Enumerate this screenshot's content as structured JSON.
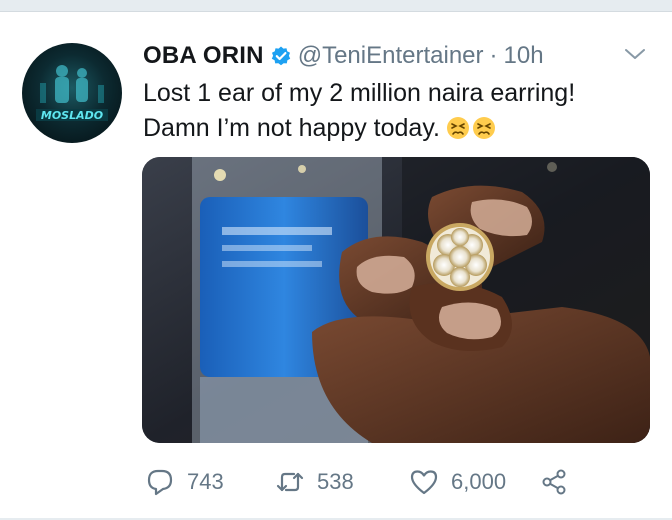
{
  "tweet": {
    "display_name": "OBA ORIN",
    "handle": "@TeniEntertainer",
    "separator": "·",
    "time": "10h",
    "text_line1": "Lost 1 ear of my 2 million naira earring!",
    "text_line2": "Damn I’m not happy today.",
    "avatar_text": "MOSLADO"
  },
  "actions": {
    "replies": "743",
    "retweets": "538",
    "likes": "6,000"
  },
  "colors": {
    "text": "#14171a",
    "secondary": "#657786",
    "verified": "#1da1f2",
    "divider": "#e6ecf0"
  },
  "icons": [
    "verified-badge-icon",
    "chevron-down-icon",
    "persevering-face-emoji",
    "reply-icon",
    "retweet-icon",
    "like-heart-icon",
    "share-icon"
  ]
}
